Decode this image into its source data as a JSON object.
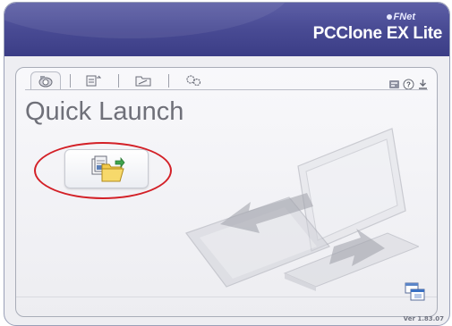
{
  "header": {
    "brand_small": "FNet",
    "product_title": "PCClone EX Lite"
  },
  "tabs": [
    {
      "name": "quick-launch",
      "icon": "camera-icon",
      "active": true
    },
    {
      "name": "files",
      "icon": "file-transfer-icon",
      "active": false
    },
    {
      "name": "backup",
      "icon": "folder-sync-icon",
      "active": false
    },
    {
      "name": "settings",
      "icon": "gears-icon",
      "active": false
    }
  ],
  "top_right_icons": [
    "registration-icon",
    "help-icon",
    "download-update-icon"
  ],
  "main": {
    "section_title": "Quick Launch"
  },
  "quick_launch_button": {
    "icon": "documents-to-folder-icon",
    "highlight_color": "#d32027"
  },
  "footer": {
    "version": "Ver 1.83.07"
  },
  "colors": {
    "header": "#4a4c95",
    "panel_bg": "#f1f1f5",
    "highlight": "#d32027"
  }
}
